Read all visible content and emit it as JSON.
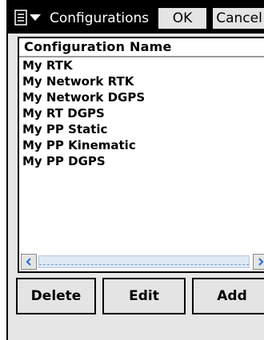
{
  "window": {
    "title": "Configurations"
  },
  "toolbar": {
    "ok_label": "OK",
    "cancel_label": "Cancel"
  },
  "list": {
    "column_header": "Configuration Name",
    "items": [
      "My RTK",
      "My Network RTK",
      "My Network DGPS",
      "My RT DGPS",
      "My PP Static",
      "My PP Kinematic",
      "My PP DGPS"
    ]
  },
  "buttons": {
    "delete": "Delete",
    "edit": "Edit",
    "add": "Add"
  },
  "icons": {
    "menu": "start-menu-icon",
    "dropdown": "triangle-down-icon",
    "scroll_left": "scroll-left-arrow-icon",
    "scroll_right": "scroll-right-arrow-icon"
  },
  "colors": {
    "title_bar": "#000000",
    "background": "#e6e6e6",
    "scroll_arrow": "#2f6fd8"
  }
}
